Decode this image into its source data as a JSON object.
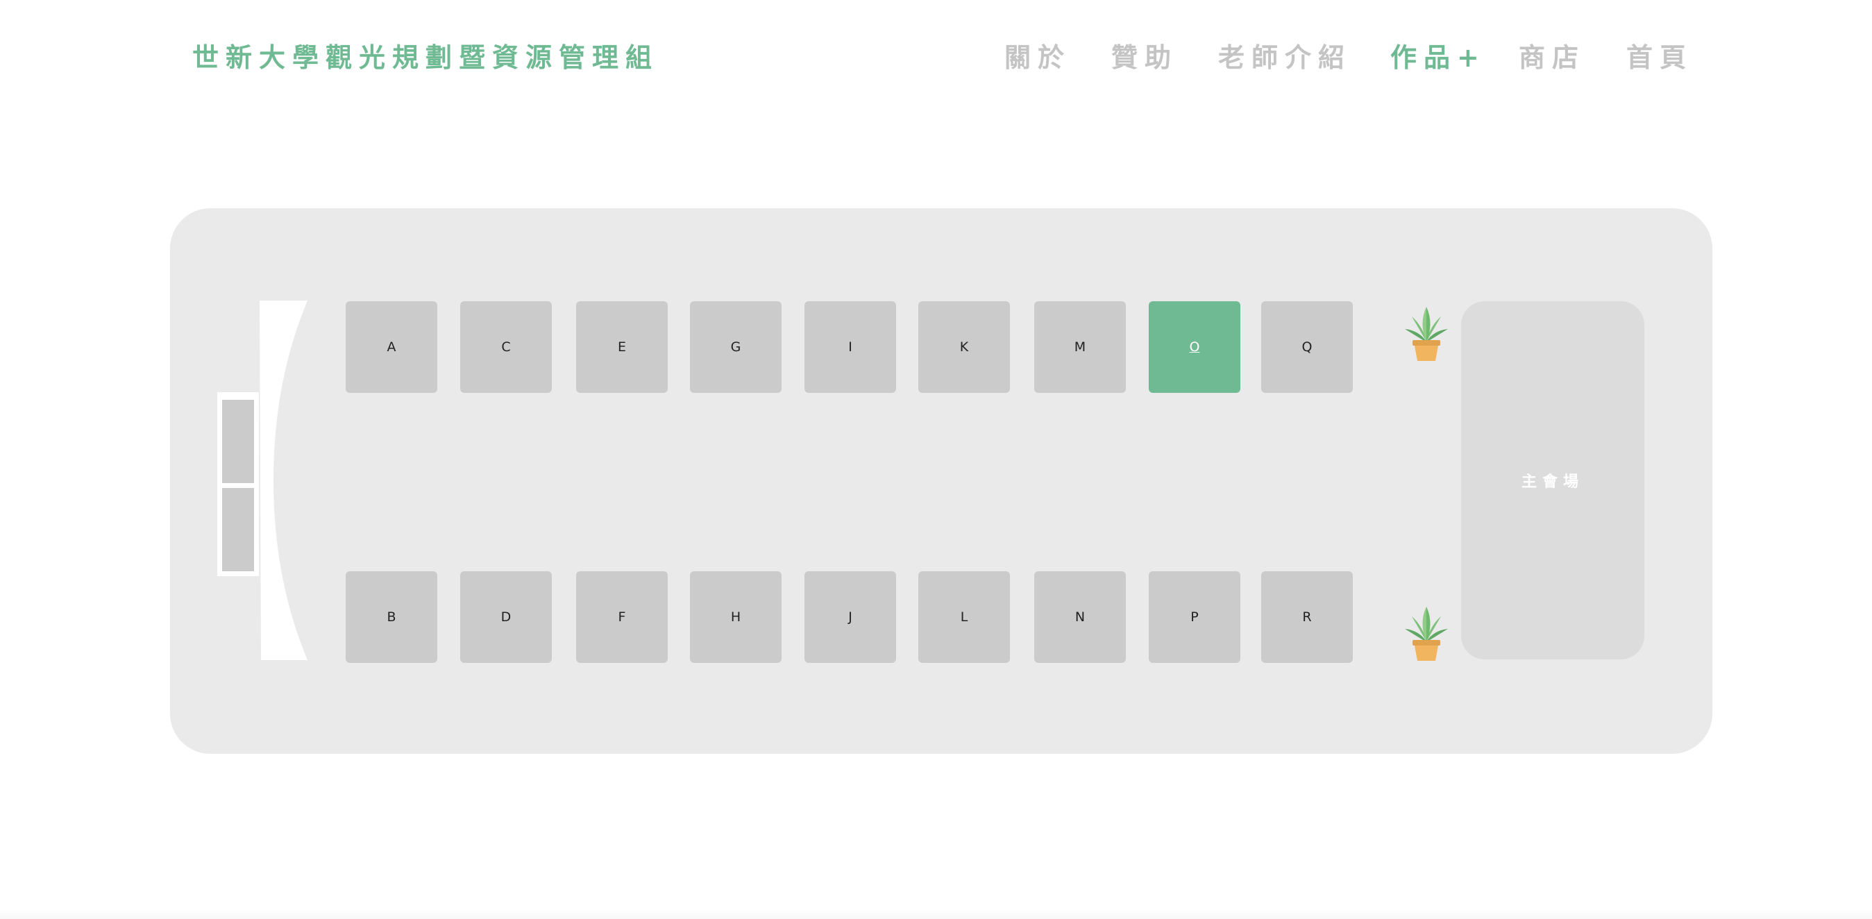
{
  "header": {
    "brand": "世新大學觀光規劃暨資源管理組",
    "nav": {
      "about": "關於",
      "sponsor": "贊助",
      "teachers": "老師介紹",
      "works": "作品+",
      "shop": "商店",
      "home": "首頁"
    }
  },
  "floorplan": {
    "booths_top": [
      "A",
      "C",
      "E",
      "G",
      "I",
      "K",
      "M",
      "O",
      "Q"
    ],
    "booths_bottom": [
      "B",
      "D",
      "F",
      "H",
      "J",
      "L",
      "N",
      "P",
      "R"
    ],
    "selected_booth": "O",
    "main_venue": "主會場"
  },
  "colors": {
    "accent": "#6fb993",
    "nav_inactive": "#c4c4c4",
    "floor": "#eaeaea",
    "booth": "#cbcbcb",
    "main_venue": "#dcdcdc"
  }
}
